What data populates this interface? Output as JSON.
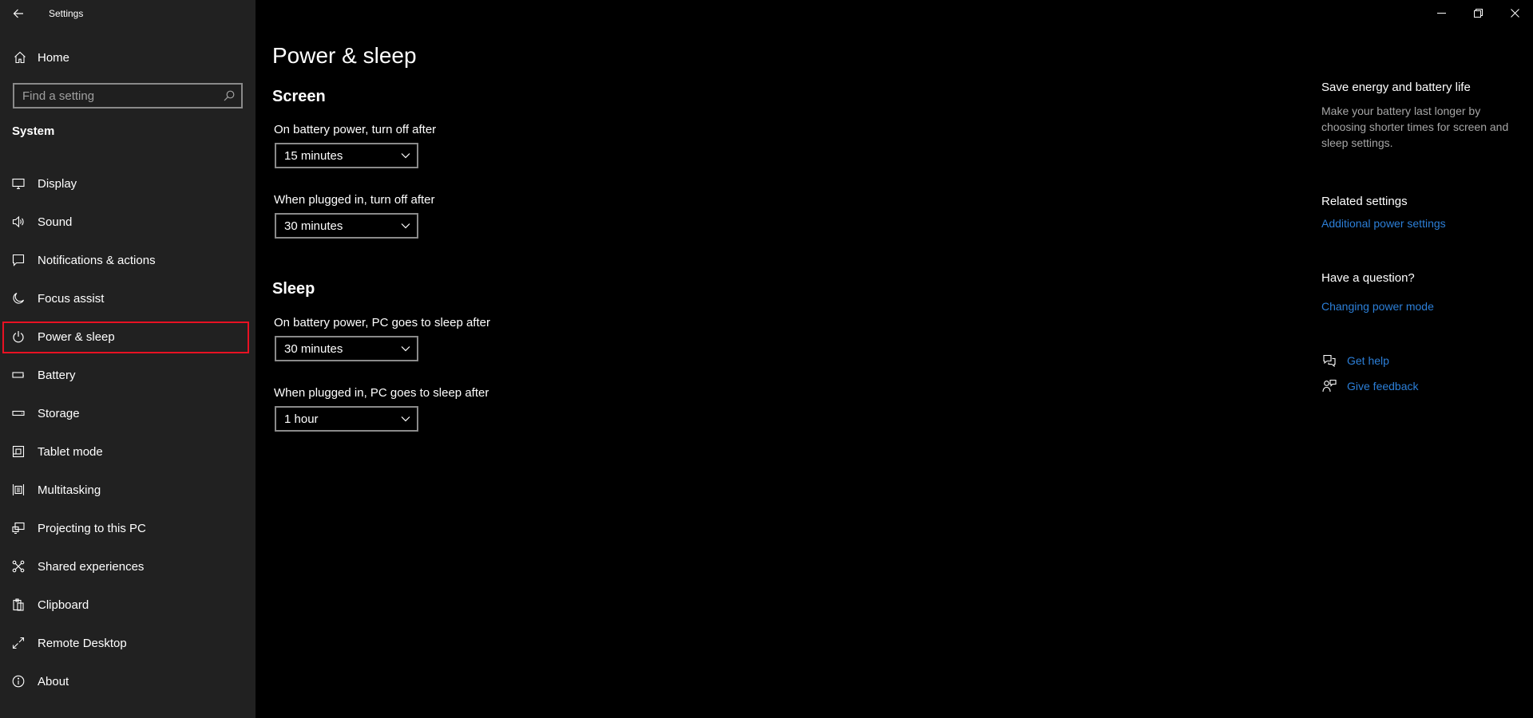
{
  "window": {
    "title": "Settings"
  },
  "sidebar": {
    "home_label": "Home",
    "search_placeholder": "Find a setting",
    "section": "System",
    "items": [
      {
        "label": "Display",
        "icon": "monitor-icon"
      },
      {
        "label": "Sound",
        "icon": "speaker-icon"
      },
      {
        "label": "Notifications & actions",
        "icon": "message-icon"
      },
      {
        "label": "Focus assist",
        "icon": "moon-icon"
      },
      {
        "label": "Power & sleep",
        "icon": "power-icon",
        "selected": true
      },
      {
        "label": "Battery",
        "icon": "battery-icon"
      },
      {
        "label": "Storage",
        "icon": "storage-icon"
      },
      {
        "label": "Tablet mode",
        "icon": "tablet-icon"
      },
      {
        "label": "Multitasking",
        "icon": "multitasking-icon"
      },
      {
        "label": "Projecting to this PC",
        "icon": "projecting-icon"
      },
      {
        "label": "Shared experiences",
        "icon": "shared-icon"
      },
      {
        "label": "Clipboard",
        "icon": "clipboard-icon"
      },
      {
        "label": "Remote Desktop",
        "icon": "remote-desktop-icon"
      },
      {
        "label": "About",
        "icon": "info-icon"
      }
    ]
  },
  "main": {
    "title": "Power & sleep",
    "screen": {
      "heading": "Screen",
      "battery_label": "On battery power, turn off after",
      "battery_value": "15 minutes",
      "plugged_label": "When plugged in, turn off after",
      "plugged_value": "30 minutes"
    },
    "sleep": {
      "heading": "Sleep",
      "battery_label": "On battery power, PC goes to sleep after",
      "battery_value": "30 minutes",
      "plugged_label": "When plugged in, PC goes to sleep after",
      "plugged_value": "1 hour"
    }
  },
  "right_panel": {
    "save_heading": "Save energy and battery life",
    "save_desc": "Make your battery last longer by choosing shorter times for screen and sleep settings.",
    "related_heading": "Related settings",
    "related_link": "Additional power settings",
    "question_heading": "Have a question?",
    "question_link": "Changing power mode",
    "get_help": "Get help",
    "give_feedback": "Give feedback"
  },
  "colors": {
    "accent_link": "#2c7fd8",
    "selection_outline": "#e81123",
    "sidebar_bg": "#212121",
    "main_bg": "#000000"
  }
}
